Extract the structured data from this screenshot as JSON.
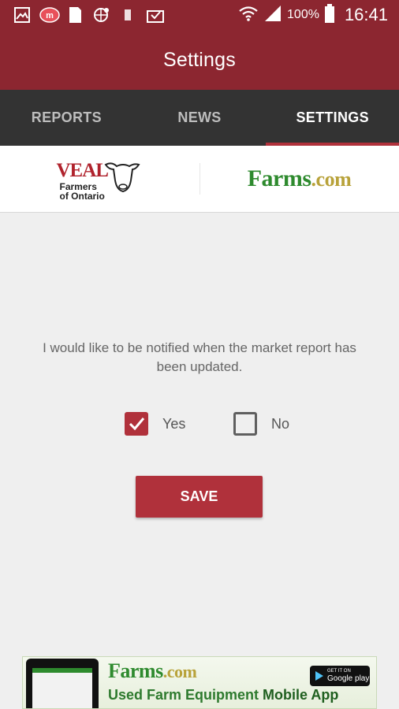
{
  "status_bar": {
    "battery": "100%",
    "time": "16:41",
    "icons": [
      "gallery-icon",
      "messenger-icon",
      "sim-icon",
      "globe-icon",
      "storage-icon",
      "inbox-icon",
      "wifi-icon",
      "signal-icon",
      "battery-icon"
    ]
  },
  "app_bar": {
    "title": "Settings"
  },
  "tabs": [
    {
      "label": "REPORTS",
      "active": false
    },
    {
      "label": "NEWS",
      "active": false
    },
    {
      "label": "SETTINGS",
      "active": true
    }
  ],
  "logos": {
    "veal": {
      "title": "VEAL",
      "line1": "Farmers",
      "line2": "of Ontario"
    },
    "farms": {
      "name": "Farms",
      "suffix": ".com"
    }
  },
  "content": {
    "prompt": "I would like to be notified when the market report has been updated.",
    "options": [
      {
        "label": "Yes",
        "checked": true
      },
      {
        "label": "No",
        "checked": false
      }
    ],
    "save_label": "SAVE"
  },
  "banner": {
    "brand": "Farms",
    "brand_suffix": ".com",
    "subtitle_a": "Used Farm Equipment ",
    "subtitle_b": "Mobile App",
    "play_top": "GET IT ON",
    "play_bottom": "Google play"
  },
  "colors": {
    "primary": "#8c2630",
    "accent": "#b0313b",
    "tabbar": "#333333",
    "farms_green": "#2e8a2e"
  }
}
